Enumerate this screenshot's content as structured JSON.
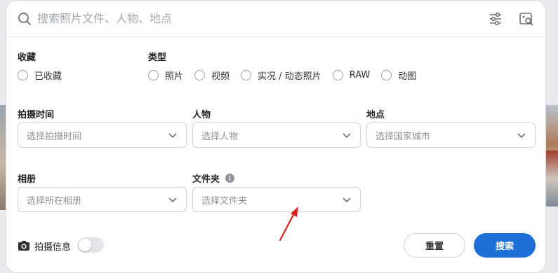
{
  "search": {
    "placeholder": "搜索照片文件、人物、地点"
  },
  "favorites": {
    "title": "收藏",
    "option": "已收藏"
  },
  "type": {
    "title": "类型",
    "options": [
      "照片",
      "视频",
      "实况 / 动态照片",
      "RAW",
      "动图"
    ]
  },
  "fields": {
    "shoot_time": {
      "label": "拍摄时间",
      "placeholder": "选择拍摄时间"
    },
    "people": {
      "label": "人物",
      "placeholder": "选择人物"
    },
    "location": {
      "label": "地点",
      "placeholder": "选择国家城市"
    },
    "album": {
      "label": "相册",
      "placeholder": "选择所在相册"
    },
    "folder": {
      "label": "文件夹",
      "placeholder": "选择文件夹"
    }
  },
  "footer": {
    "shoot_info_label": "拍摄信息",
    "shoot_info_enabled": false,
    "reset_label": "重置",
    "search_label": "搜索"
  },
  "colors": {
    "accent": "#1f6fd9",
    "annotation_arrow": "#e0201a"
  },
  "icons": [
    "search-icon",
    "filter-sliders-icon",
    "image-search-icon",
    "chevron-down-icon",
    "info-icon",
    "camera-icon"
  ]
}
